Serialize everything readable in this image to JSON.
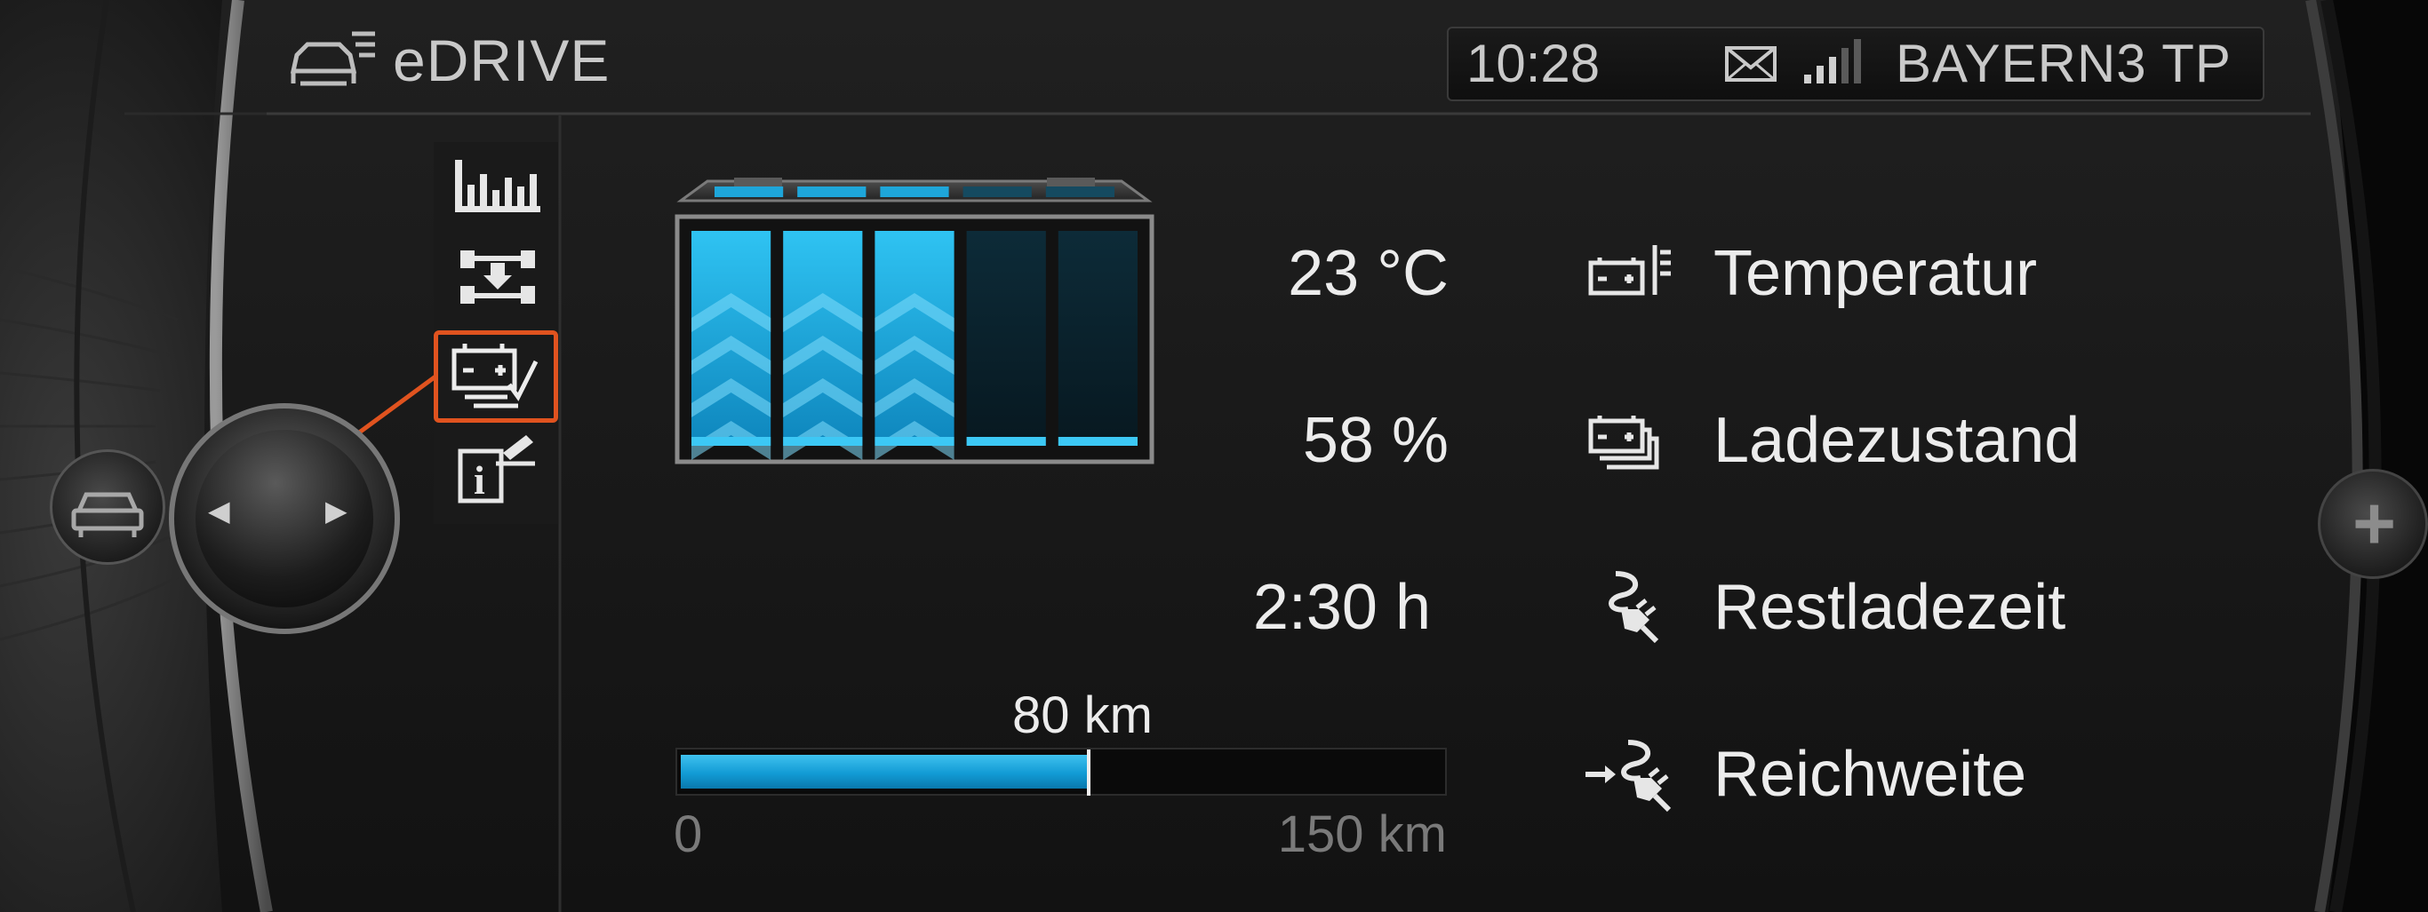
{
  "header": {
    "title": "eDRIVE",
    "icon": "car-settings-icon"
  },
  "status_bar": {
    "time": "10:28",
    "station": "BAYERN3  TP",
    "icons": [
      "mail-icon",
      "signal-strength-icon"
    ]
  },
  "sidebar_menu": {
    "items": [
      {
        "id": "consumption",
        "icon": "bar-chart-icon",
        "selected": false
      },
      {
        "id": "drive-mode",
        "icon": "vehicle-transfer-icon",
        "selected": false
      },
      {
        "id": "battery-status",
        "icon": "battery-check-icon",
        "selected": true
      },
      {
        "id": "info",
        "icon": "info-edit-icon",
        "selected": false
      }
    ]
  },
  "controller": {
    "left_arrow": "◀",
    "right_arrow": "▶",
    "car_button_icon": "car-front-icon",
    "plus_button": "+"
  },
  "battery": {
    "total_segments": 5,
    "filled_segments": 3,
    "fill_color": "#1fb1e8"
  },
  "rows": [
    {
      "value": "23 °C",
      "label": "Temperatur",
      "icon": "battery-thermometer-icon"
    },
    {
      "value": "58 %",
      "label": "Ladezustand",
      "icon": "battery-stack-icon"
    },
    {
      "value": "2:30  h",
      "label": "Restladezeit",
      "icon": "charging-plug-icon"
    },
    {
      "value": "",
      "label": "Reichweite",
      "icon": "range-plug-icon"
    }
  ],
  "range": {
    "current_label": "80 km",
    "min_label": "0",
    "max_label": "150 km",
    "current": 80,
    "max": 150
  },
  "colors": {
    "accent_blue": "#1fb1e8",
    "highlight_orange": "#e0531f",
    "text": "#ececec",
    "muted": "#7a7a7a"
  }
}
